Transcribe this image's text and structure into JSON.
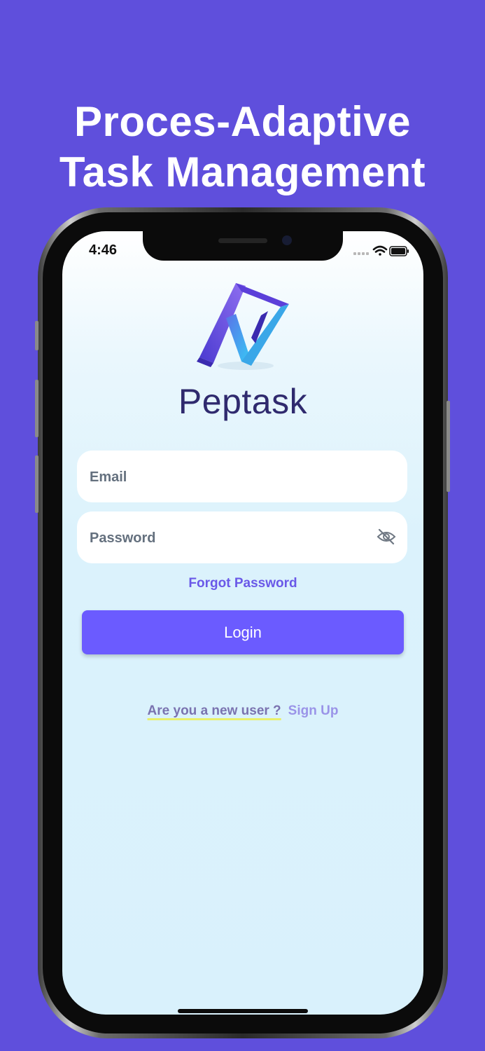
{
  "headline": {
    "line1": "Proces-Adaptive",
    "line2": "Task Management"
  },
  "status_bar": {
    "time": "4:46",
    "icons": [
      "signal-icon",
      "wifi-icon",
      "battery-icon"
    ]
  },
  "app": {
    "brand_name": "Peptask"
  },
  "form": {
    "email_placeholder": "Email",
    "email_value": "",
    "password_placeholder": "Password",
    "password_value": "",
    "forgot_label": "Forgot Password",
    "login_label": "Login"
  },
  "footer": {
    "new_user_label": "Are you a new user ?",
    "signup_label": "Sign Up"
  },
  "colors": {
    "background": "#5f4fdc",
    "accent": "#6b5bff",
    "brand_text": "#2f2a6e"
  }
}
